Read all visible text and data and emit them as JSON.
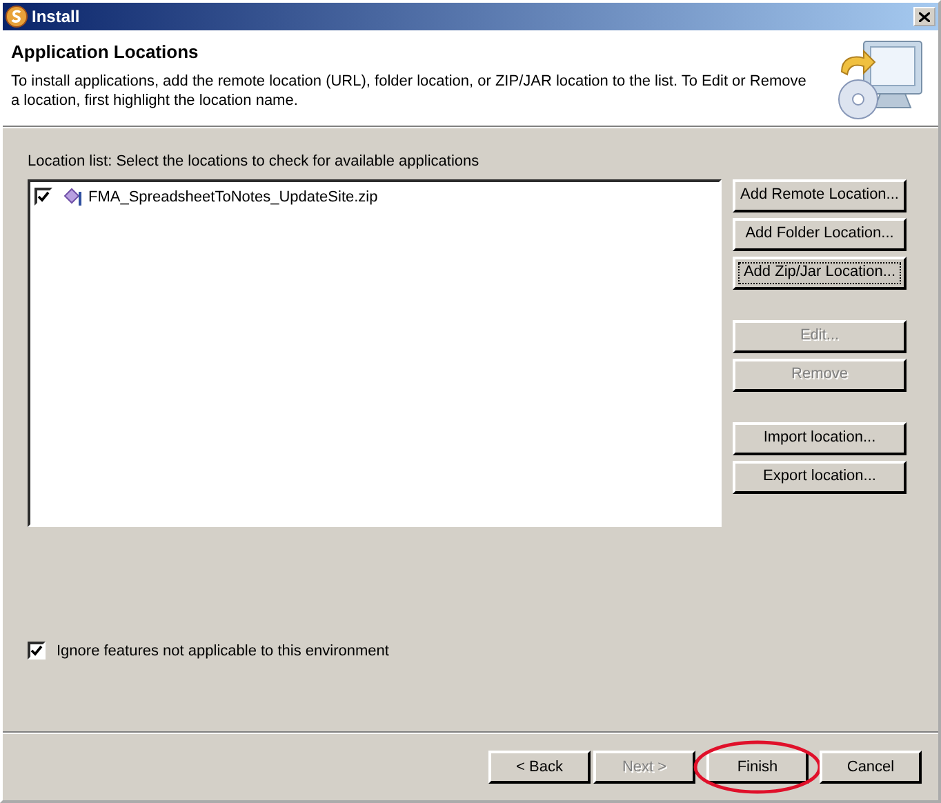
{
  "window": {
    "title": "Install"
  },
  "header": {
    "title": "Application Locations",
    "description": "To install applications, add the remote location (URL), folder location, or ZIP/JAR location to the list. To Edit or Remove a location, first highlight the location name."
  },
  "location_list": {
    "label": "Location list: Select the locations to check for available applications",
    "items": [
      {
        "name": "FMA_SpreadsheetToNotes_UpdateSite.zip",
        "checked": true
      }
    ]
  },
  "side_buttons": [
    [
      {
        "label": "Add Remote Location...",
        "disabled": false,
        "focused": false
      },
      {
        "label": "Add Folder Location...",
        "disabled": false,
        "focused": false
      },
      {
        "label": "Add Zip/Jar Location...",
        "disabled": false,
        "focused": true
      }
    ],
    [
      {
        "label": "Edit...",
        "disabled": true,
        "focused": false
      },
      {
        "label": "Remove",
        "disabled": true,
        "focused": false
      }
    ],
    [
      {
        "label": "Import location...",
        "disabled": false,
        "focused": false
      },
      {
        "label": "Export location...",
        "disabled": false,
        "focused": false
      }
    ]
  ],
  "ignore_option": {
    "label": "Ignore features not applicable to this environment",
    "checked": true
  },
  "footer_buttons": [
    {
      "label": "< Back",
      "disabled": false,
      "circled": false
    },
    {
      "label": "Next >",
      "disabled": true,
      "circled": false
    },
    {
      "label": "Finish",
      "disabled": false,
      "circled": true
    },
    {
      "label": "Cancel",
      "disabled": false,
      "circled": false
    }
  ]
}
